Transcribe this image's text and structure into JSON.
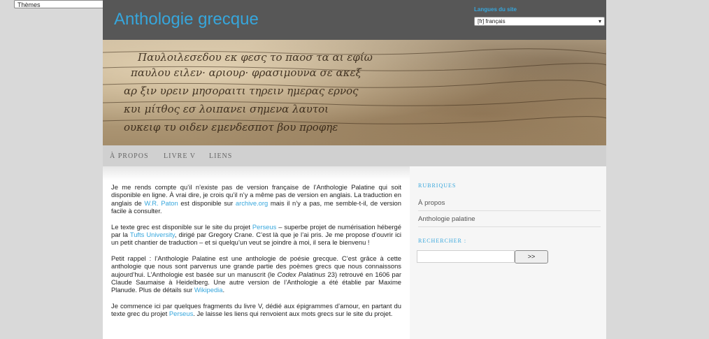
{
  "theme_selector": {
    "value": "Thèmes",
    "icon": "chevron-down-icon"
  },
  "header": {
    "title": "Anthologie grecque",
    "language_label": "Langues du site",
    "language_value": "[fr] français"
  },
  "banner": {
    "manuscript_lines": [
      "Παυλοιλεσεδου εκ φεσς  το   παοσ τα αι εφίω",
      "παυλου ειλεν· αριουρ· φρασιμουνα σε ακεξ",
      "αρ ξιν υρειν μησοραιτι  τηρειν  ημερας   ερνος",
      "κυι μίτθος  εσ  λοιπανει   σημενα       λαυτοι",
      "ουκειφ  τυ    οιδεν  εμενδεσποτ βου     προφηε"
    ]
  },
  "nav": {
    "items": [
      "À PROPOS",
      "LIVRE V",
      "LIENS"
    ]
  },
  "content": {
    "p1": {
      "t1": "Je me rends compte qu’il n’existe pas de version française de l’Anthologie Palatine qui soit disponible en ligne. À vrai dire, je crois qu’il n’y a même pas de version en anglais. La traduction en anglais de ",
      "link1": "W.R. Paton",
      "t2": " est disponible sur ",
      "link2": "archive.org",
      "t3": " mais il n’y a pas, me semble-t-il, de version facile à consulter."
    },
    "p2": {
      "t1": "Le texte grec est disponible sur le site du projet ",
      "link1": "Perseus",
      "t2": " – superbe projet de numérisation hébergé par la ",
      "link2": "Tufts University",
      "t3": ", dirigé par Gregory Crane. C’est là que je l’ai pris. Je me propose d’ouvrir ici un petit chantier de traduction – et si quelqu’un veut se joindre à moi, il sera le bienvenu !"
    },
    "p3": {
      "t1": "Petit rappel : l’Anthologie Palatine est une anthologie de poésie grecque. C’est grâce à cette anthologie que nous sont parvenus une grande partie des poèmes grecs que nous connaissons aujourd’hui. L’Anthologie est basée sur un manuscrit (le ",
      "italic": "Codex Palatinus",
      "t2": " 23) retrouvé en 1606 par Claude Saumaise à Heidelberg. Une autre version de l’Anthologie a été établie par Maxime Planude. Plus de détails sur ",
      "link1": "Wikipedia",
      "t3": "."
    },
    "p4": {
      "t1": "Je commence ici par quelques fragments du livre V, dédié aux épigrammes d’amour, en partant du texte grec du projet ",
      "link1": "Perseus",
      "t2": ". Je laisse les liens qui renvoient aux mots grecs sur le site du projet."
    }
  },
  "sidebar": {
    "rubriques_heading": "RUBRIQUES",
    "links": [
      "À propos",
      "Anthologie palatine"
    ],
    "search_heading": "RECHERCHER :",
    "search_value": "",
    "search_button": ">>"
  },
  "colors": {
    "accent": "#36a6dc",
    "header_bg": "#575757",
    "nav_bg": "#d0d0d0"
  }
}
